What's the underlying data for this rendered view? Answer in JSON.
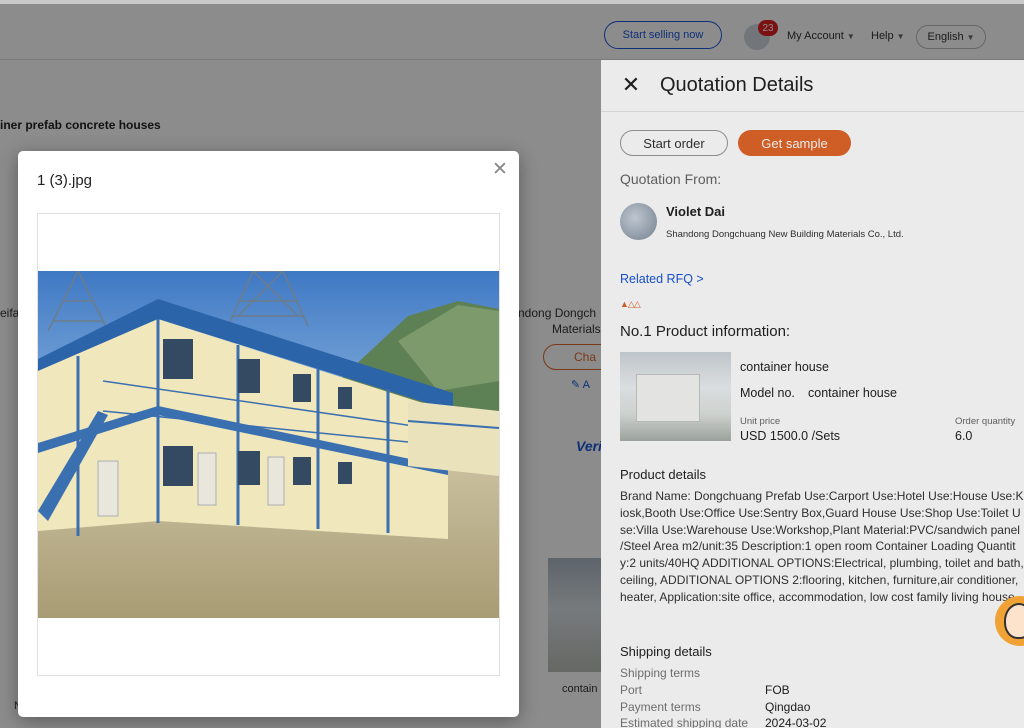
{
  "header": {
    "start_selling": "Start selling now",
    "message_count": "23",
    "my_account": "My Account",
    "help": "Help",
    "language": "English"
  },
  "background": {
    "product_title_fragment": "iner prefab concrete houses",
    "left_fragment": "eifa",
    "supplier_fragment_1": "ndong Dongch",
    "supplier_fragment_2": "Materials",
    "chat_fragment": "Cha",
    "add_fragment": "A",
    "verified_fragment": "Veri",
    "thumb_caption_fragment": "contain",
    "bottom_left_fragment": "N"
  },
  "drawer": {
    "title": "Quotation Details",
    "start_order": "Start order",
    "get_sample": "Get sample",
    "quotation_from": "Quotation From:",
    "supplier": {
      "name": "Violet Dai",
      "company": "Shandong Dongchuang New Building Materials Co., Ltd."
    },
    "related_rfq": "Related RFQ >",
    "product_info_title": "No.1 Product information:",
    "product": {
      "name": "container house",
      "model_label": "Model no.",
      "model_value": "container house",
      "unit_price_label": "Unit price",
      "unit_price": "USD 1500.0 /Sets",
      "order_qty_label": "Order quantity",
      "order_qty": "6.0"
    },
    "product_details_title": "Product details",
    "product_details_text": "Brand Name: Dongchuang Prefab Use:Carport Use:Hotel Use:House Use:Kiosk,Booth Use:Office Use:Sentry Box,Guard House Use:Shop Use:Toilet Use:Villa Use:Warehouse Use:Workshop,Plant Material:PVC/sandwich panel /Steel Area m2/unit:35 Description:1 open room Container Loading Quantity:2 units/40HQ ADDITIONAL OPTIONS:Electrical, plumbing, toilet and bath, ceiling, ADDITIONAL OPTIONS 2:flooring, kitchen, furniture,air conditioner, heater, Application:site office, accommodation, low cost family living house",
    "shipping_title": "Shipping details",
    "shipping": {
      "terms_label": "Shipping terms",
      "port_label": "Port",
      "port_value": "FOB",
      "payment_label": "Payment terms",
      "payment_value": "Qingdao",
      "date_label": "Estimated shipping date",
      "date_value": "2024-03-02"
    }
  },
  "modal": {
    "title": "1 (3).jpg"
  },
  "colors": {
    "accent_orange": "#e0662a",
    "link_blue": "#1a56db",
    "badge_red": "#e02020"
  }
}
